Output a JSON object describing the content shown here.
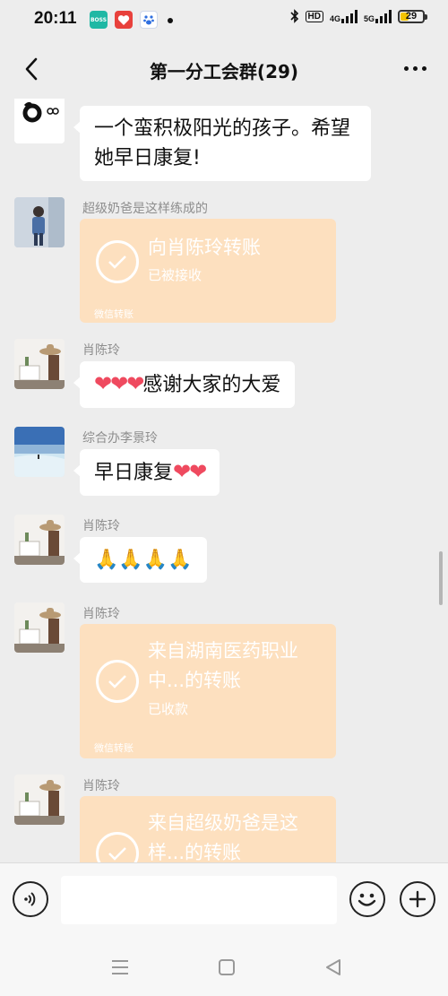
{
  "status_bar": {
    "time": "20:11",
    "apps": [
      {
        "name": "boss-app-icon",
        "label": "BOSS",
        "color": "#1fb8a4"
      },
      {
        "name": "heart-app-icon",
        "label": "",
        "color": "#e8413c"
      },
      {
        "name": "paw-app-icon",
        "label": "",
        "color": "#2f6fe0"
      }
    ],
    "hd_label": "HD",
    "signal_1": "4G",
    "signal_2": "5G",
    "battery": "29"
  },
  "header": {
    "title": "第一分工会群(29)",
    "back_icon": "chevron-left-icon",
    "more_icon": "more-dots-icon"
  },
  "messages": [
    {
      "sender": "",
      "type": "text",
      "text": "一个蛮积极阳光的孩子。希望她早日康复!"
    },
    {
      "sender": "超级奶爸是这样练成的",
      "type": "transfer",
      "title": "向肖陈玲转账",
      "status": "已被接收",
      "footer": "微信转账"
    },
    {
      "sender": "肖陈玲",
      "type": "text",
      "prefix": "❤❤❤",
      "text": "感谢大家的大爱"
    },
    {
      "sender": "综合办李景玲",
      "type": "text",
      "text": "早日康复",
      "suffix": "❤❤"
    },
    {
      "sender": "肖陈玲",
      "type": "text",
      "text": "🙏🙏🙏🙏"
    },
    {
      "sender": "肖陈玲",
      "type": "transfer",
      "title": "来自湖南医药职业中...的转账",
      "status": "已收款",
      "footer": "微信转账"
    },
    {
      "sender": "肖陈玲",
      "type": "transfer",
      "title": "来自超级奶爸是这样...的转账",
      "status": "",
      "footer": ""
    }
  ],
  "input_bar": {
    "placeholder": "",
    "voice_icon": "voice-icon",
    "emoji_icon": "emoji-icon",
    "plus_icon": "plus-icon"
  },
  "colors": {
    "background": "#ededed",
    "transfer_bubble": "#fde0bf",
    "bubble": "#ffffff",
    "heart": "#ef4a5f"
  }
}
